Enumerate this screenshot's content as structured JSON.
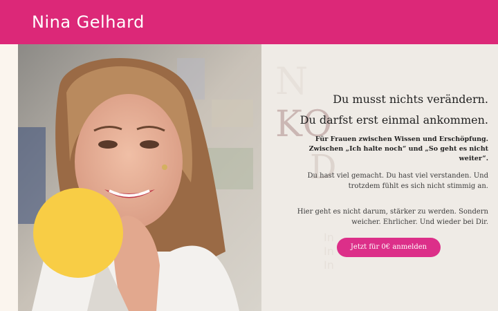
{
  "brand": "Nina Gelhard",
  "hero": {
    "headline_1": "Du musst nichts verändern.",
    "headline_2": "Du darfst erst einmal ankommen.",
    "subline_bold": "Für Frauen zwischen Wissen und Erschöpfung. Zwischen „Ich halte noch“ und „So geht es nicht weiter“.",
    "paragraph_1": "Du hast viel gemacht. Du hast viel verstanden. Und trotzdem fühlt es sich nicht stimmig an.",
    "paragraph_2": "Hier geht es nicht darum, stärker zu werden. Sondern weicher. Ehrlicher. Und wieder bei Dir.",
    "cta_label": "Jetzt für 0€ anmelden"
  },
  "colors": {
    "header": "#dc2878",
    "cta": "#dc2f89",
    "accent_circle": "#f8cd45",
    "panel": "#efebe6"
  }
}
